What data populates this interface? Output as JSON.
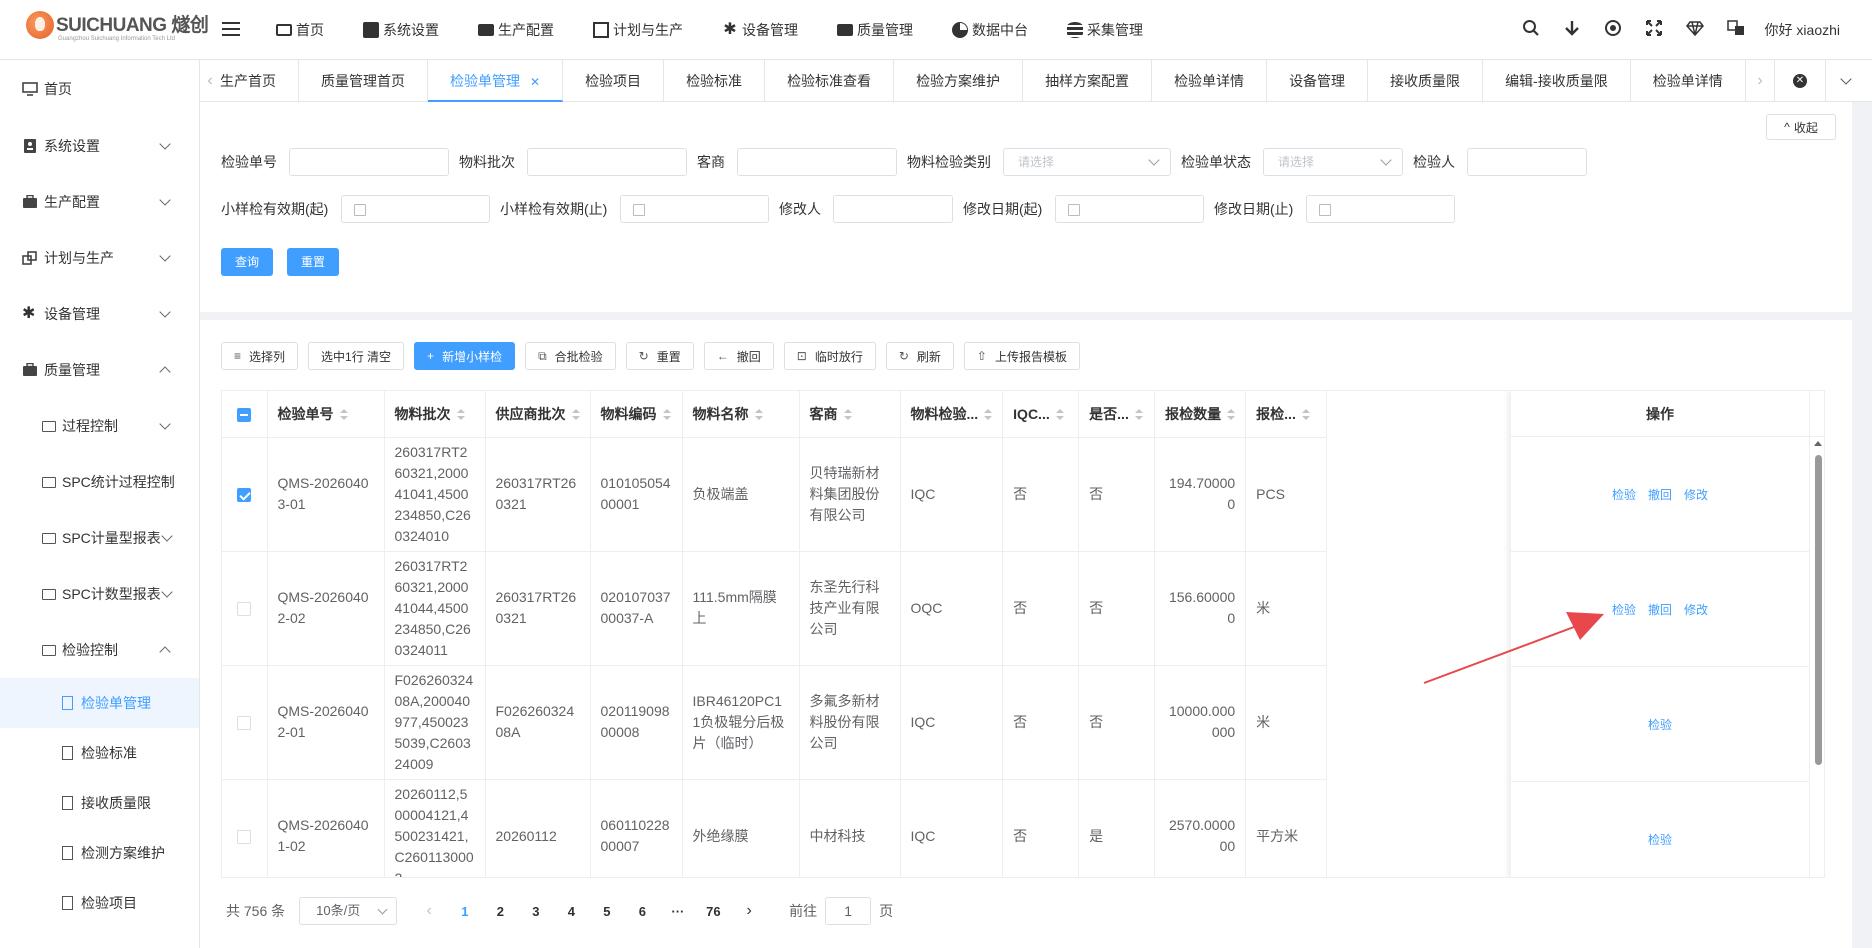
{
  "app": {
    "brand": "SUICHUANG 燧创",
    "brand_sub": "Guangzhou Suichuang Information Tech Ltd",
    "user_greeting": "你好 xiaozhi"
  },
  "topnav": [
    {
      "label": "首页",
      "icon": "monitor-icon"
    },
    {
      "label": "系统设置",
      "icon": "user-card-icon"
    },
    {
      "label": "生产配置",
      "icon": "briefcase-icon"
    },
    {
      "label": "计划与生产",
      "icon": "grid-icon"
    },
    {
      "label": "设备管理",
      "icon": "gear-icon"
    },
    {
      "label": "质量管理",
      "icon": "briefcase-icon"
    },
    {
      "label": "数据中台",
      "icon": "pie-icon"
    },
    {
      "label": "采集管理",
      "icon": "database-icon"
    }
  ],
  "sidebar": {
    "items": [
      {
        "label": "首页"
      },
      {
        "label": "系统设置"
      },
      {
        "label": "生产配置"
      },
      {
        "label": "计划与生产"
      },
      {
        "label": "设备管理"
      },
      {
        "label": "质量管理"
      }
    ],
    "quality_children": [
      {
        "label": "过程控制"
      },
      {
        "label": "SPC统计过程控制"
      },
      {
        "label": "SPC计量型报表"
      },
      {
        "label": "SPC计数型报表"
      },
      {
        "label": "检验控制"
      }
    ],
    "inspection_children": [
      {
        "label": "检验单管理"
      },
      {
        "label": "检验标准"
      },
      {
        "label": "接收质量限"
      },
      {
        "label": "检测方案维护"
      },
      {
        "label": "检验项目"
      }
    ]
  },
  "tabs": [
    {
      "label": "生产首页"
    },
    {
      "label": "质量管理首页"
    },
    {
      "label": "检验单管理"
    },
    {
      "label": "检验项目"
    },
    {
      "label": "检验标准"
    },
    {
      "label": "检验标准查看"
    },
    {
      "label": "检验方案维护"
    },
    {
      "label": "抽样方案配置"
    },
    {
      "label": "检验单详情"
    },
    {
      "label": "设备管理"
    },
    {
      "label": "接收质量限"
    },
    {
      "label": "编辑-接收质量限"
    },
    {
      "label": "检验单详情"
    }
  ],
  "filter": {
    "collapse_label": "收起",
    "inspection_no": "检验单号",
    "material_batch": "物料批次",
    "customer": "客商",
    "material_category": "物料检验类别",
    "category_placeholder": "请选择",
    "status": "检验单状态",
    "status_placeholder": "请选择",
    "inspector": "检验人",
    "small_valid_start": "小样检有效期(起)",
    "small_valid_end": "小样检有效期(止)",
    "modifier": "修改人",
    "modify_date_start": "修改日期(起)",
    "modify_date_end": "修改日期(止)",
    "query_button": "查询",
    "reset_button": "重置"
  },
  "toolbar": [
    {
      "label": "选择列",
      "icon": "≡"
    },
    {
      "label": "选中1行 清空",
      "icon": ""
    },
    {
      "label": "新增小样检",
      "icon": "+"
    },
    {
      "label": "合批检验",
      "icon": "⧉"
    },
    {
      "label": "重置",
      "icon": "↻"
    },
    {
      "label": "撤回",
      "icon": "←"
    },
    {
      "label": "临时放行",
      "icon": "🔒"
    },
    {
      "label": "刷新",
      "icon": "↻"
    },
    {
      "label": "上传报告模板",
      "icon": "⇧"
    }
  ],
  "table": {
    "columns": [
      "检验单号",
      "物料批次",
      "供应商批次",
      "物料编码",
      "物料名称",
      "客商",
      "物料检验...",
      "IQC...",
      "是否...",
      "报检数量",
      "报检..."
    ],
    "ops_header": "操作",
    "rows": [
      {
        "checked": true,
        "cells": [
          "QMS-20260403-01",
          "260317RT260321,200041041,4500234850,C260324010",
          "260317RT260321",
          "01010505400001",
          "负极端盖",
          "贝特瑞新材料集团股份有限公司",
          "IQC",
          "否",
          "否",
          "194.700000",
          "PCS"
        ],
        "ops": [
          "检验",
          "撤回",
          "修改"
        ]
      },
      {
        "checked": false,
        "cells": [
          "QMS-20260402-02",
          "260317RT260321,200041044,4500234850,C260324011",
          "260317RT260321",
          "02010703700037-A",
          "111.5mm隔膜上",
          "东圣先行科技产业有限公司",
          "OQC",
          "否",
          "否",
          "156.600000",
          "米"
        ],
        "ops": [
          "检验",
          "撤回",
          "修改"
        ]
      },
      {
        "checked": false,
        "cells": [
          "QMS-20260402-01",
          "F02626032408A,200040977,4500235039,C260324009",
          "F02626032408A",
          "02011909800008",
          "IBR46120PC11负极辊分后极片（临时）",
          "多氟多新材料股份有限公司",
          "IQC",
          "否",
          "否",
          "10000.000000",
          "米"
        ],
        "ops": [
          "检验"
        ]
      },
      {
        "checked": false,
        "cells": [
          "QMS-20260401-02",
          "20260112,500004121,4500231421,C2601130002",
          "20260112",
          "06011022800007",
          "外绝缘膜",
          "中材科技",
          "IQC",
          "否",
          "是",
          "2570.000000",
          "平方米"
        ],
        "ops": [
          "检验"
        ]
      }
    ]
  },
  "pager": {
    "total": "共 756 条",
    "page_size": "10条/页",
    "pages": [
      "1",
      "2",
      "3",
      "4",
      "5",
      "6",
      "···",
      "76"
    ],
    "goto_prefix": "前往",
    "goto_value": "1",
    "goto_suffix": "页"
  },
  "colors": {
    "accent": "#409eff",
    "annotation_arrow": "#e8474c"
  }
}
